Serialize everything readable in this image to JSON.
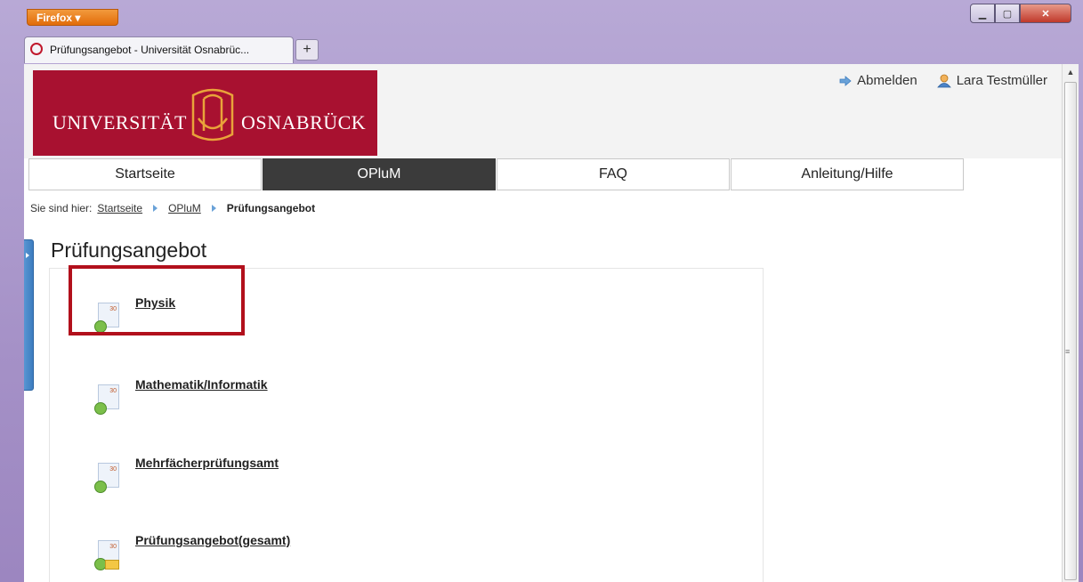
{
  "browser": {
    "menu_label": "Firefox",
    "tab_title": "Prüfungsangebot - Universität Osnabrüc...",
    "new_tab_label": "+"
  },
  "logo": {
    "left_text": "UNIVERSITÄT",
    "right_text": "OSNABRÜCK"
  },
  "user_bar": {
    "logout_label": "Abmelden",
    "user_name": "Lara Testmüller"
  },
  "nav": {
    "items": [
      {
        "label": "Startseite"
      },
      {
        "label": "OPluM"
      },
      {
        "label": "FAQ"
      },
      {
        "label": "Anleitung/Hilfe"
      }
    ]
  },
  "breadcrumb": {
    "prefix": "Sie sind hier:",
    "items": [
      {
        "label": "Startseite"
      },
      {
        "label": "OPluM"
      },
      {
        "label": "Prüfungsangebot"
      }
    ]
  },
  "page": {
    "title": "Prüfungsangebot",
    "entries": [
      {
        "label": "Physik"
      },
      {
        "label": "Mathematik/Informatik"
      },
      {
        "label": "Mehrfächerprüfungsamt"
      },
      {
        "label": "Prüfungsangebot(gesamt)"
      }
    ]
  },
  "colors": {
    "brand": "#a81130",
    "highlight": "#b2101c",
    "nav_active": "#3b3b3b"
  }
}
